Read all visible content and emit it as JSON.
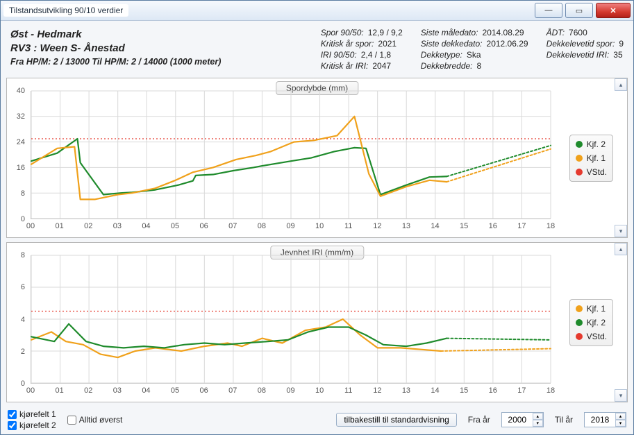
{
  "window": {
    "title": "Tilstandsutvikling 90/10 verdier"
  },
  "header": {
    "region": "Øst - Hedmark",
    "road": "RV3 : Ween S- Ånestad",
    "range": "Fra HP/M: 2 / 13000 Til HP/M: 2 / 14000 (1000 meter)",
    "col1": [
      {
        "lbl": "Spor 90/50:",
        "val": "12,9 / 9,2"
      },
      {
        "lbl": "Kritisk år spor:",
        "val": "2021"
      },
      {
        "lbl": "IRI 90/50:",
        "val": "2,4 / 1,8"
      },
      {
        "lbl": "Kritisk år IRI:",
        "val": "2047"
      }
    ],
    "col2": [
      {
        "lbl": "Siste måledato:",
        "val": "2014.08.29"
      },
      {
        "lbl": "Siste dekkedato:",
        "val": "2012.06.29"
      },
      {
        "lbl": "Dekketype:",
        "val": "Ska"
      },
      {
        "lbl": "Dekkebredde:",
        "val": "8"
      }
    ],
    "col3": [
      {
        "lbl": "ÅDT:",
        "val": "7600"
      },
      {
        "lbl": "Dekkelevetid spor:",
        "val": "9"
      },
      {
        "lbl": "Dekkelevetid IRI:",
        "val": "35"
      }
    ]
  },
  "footer": {
    "k1": "kjørefelt 1",
    "k2": "kjørefelt 2",
    "always": "Alltid øverst",
    "reset": "tilbakestill til standardvisning",
    "fra": "Fra år",
    "til": "Til år",
    "fraVal": "2000",
    "tilVal": "2018"
  },
  "chart_data": [
    {
      "type": "line",
      "title": "Spordybde (mm)",
      "x": [
        0,
        1,
        2,
        3,
        4,
        5,
        6,
        7,
        8,
        9,
        10,
        11,
        12,
        13,
        14,
        15,
        16,
        17,
        18
      ],
      "xticklabels": [
        "00",
        "01",
        "02",
        "03",
        "04",
        "05",
        "06",
        "07",
        "08",
        "09",
        "10",
        "11",
        "12",
        "13",
        "14",
        "15",
        "16",
        "17",
        "18"
      ],
      "ylim": [
        0,
        40
      ],
      "yticks": [
        0,
        8,
        16,
        24,
        32,
        40
      ],
      "threshold": 25,
      "series": [
        {
          "name": "Kjf. 2",
          "color": "#1f8b2c",
          "x": [
            0,
            0.9,
            1.6,
            1.7,
            2.5,
            3.1,
            3.5,
            4.3,
            5.1,
            5.6,
            5.7,
            6.3,
            7.0,
            7.7,
            8.0,
            9.0,
            9.7,
            10.5,
            11.2,
            11.6,
            12.1,
            13.0,
            13.8,
            14.4
          ],
          "y": [
            18.0,
            20.5,
            25.0,
            17.5,
            7.5,
            8.0,
            8.2,
            9.0,
            10.5,
            11.8,
            13.5,
            13.8,
            15.0,
            16.0,
            16.5,
            18.0,
            19.0,
            21.0,
            22.2,
            22.0,
            7.5,
            10.5,
            13.0,
            13.2
          ],
          "proj_x": [
            14.4,
            18
          ],
          "proj_y": [
            13.2,
            22.9
          ]
        },
        {
          "name": "Kjf. 1",
          "color": "#f0a11b",
          "x": [
            0,
            0.9,
            1.5,
            1.7,
            2.2,
            3.0,
            3.5,
            4.3,
            5.0,
            5.6,
            6.3,
            7.1,
            7.8,
            8.3,
            9.1,
            9.8,
            10.6,
            11.2,
            11.7,
            12.1,
            13.0,
            13.8,
            14.4
          ],
          "y": [
            17.0,
            22.0,
            22.5,
            6.0,
            6.0,
            7.5,
            8.0,
            9.5,
            12.0,
            14.5,
            16.0,
            18.5,
            19.8,
            21.0,
            24.0,
            24.5,
            26.0,
            32.0,
            14.0,
            7.0,
            10.0,
            12.0,
            11.5
          ],
          "proj_x": [
            14.4,
            18
          ],
          "proj_y": [
            11.5,
            21.8
          ]
        }
      ],
      "legend": [
        {
          "name": "Kjf. 2",
          "color": "#1f8b2c"
        },
        {
          "name": "Kjf. 1",
          "color": "#f0a11b"
        },
        {
          "name": "VStd.",
          "color": "#e53a2e"
        }
      ]
    },
    {
      "type": "line",
      "title": "Jevnhet IRI (mm/m)",
      "x": [
        0,
        1,
        2,
        3,
        4,
        5,
        6,
        7,
        8,
        9,
        10,
        11,
        12,
        13,
        14,
        15,
        16,
        17,
        18
      ],
      "xticklabels": [
        "00",
        "01",
        "02",
        "03",
        "04",
        "05",
        "06",
        "07",
        "08",
        "09",
        "10",
        "11",
        "12",
        "13",
        "14",
        "15",
        "16",
        "17",
        "18"
      ],
      "ylim": [
        0,
        8
      ],
      "yticks": [
        0,
        2,
        4,
        6,
        8
      ],
      "threshold": 4.5,
      "series": [
        {
          "name": "Kjf. 1",
          "color": "#f0a11b",
          "x": [
            0,
            0.7,
            1.2,
            1.8,
            2.4,
            3.0,
            3.6,
            4.3,
            5.2,
            6.0,
            6.8,
            7.3,
            8.0,
            8.7,
            9.5,
            10.2,
            10.8,
            11.4,
            12.0,
            12.8,
            13.5,
            14.2
          ],
          "y": [
            2.7,
            3.2,
            2.6,
            2.4,
            1.8,
            1.6,
            2.0,
            2.2,
            2.0,
            2.3,
            2.5,
            2.3,
            2.8,
            2.5,
            3.3,
            3.5,
            4.0,
            3.0,
            2.2,
            2.2,
            2.1,
            2.0
          ],
          "proj_x": [
            14.2,
            18
          ],
          "proj_y": [
            2.0,
            2.15
          ]
        },
        {
          "name": "Kjf. 2",
          "color": "#1f8b2c",
          "x": [
            0,
            0.8,
            1.3,
            1.9,
            2.5,
            3.2,
            3.9,
            4.6,
            5.3,
            6.0,
            6.7,
            7.4,
            8.2,
            8.9,
            9.6,
            10.3,
            11.0,
            11.6,
            12.2,
            13.0,
            13.7,
            14.4
          ],
          "y": [
            2.9,
            2.6,
            3.7,
            2.6,
            2.3,
            2.2,
            2.3,
            2.2,
            2.4,
            2.5,
            2.4,
            2.5,
            2.6,
            2.7,
            3.2,
            3.5,
            3.5,
            3.0,
            2.4,
            2.3,
            2.5,
            2.8
          ],
          "proj_x": [
            14.4,
            18
          ],
          "proj_y": [
            2.8,
            2.7
          ]
        }
      ],
      "legend": [
        {
          "name": "Kjf. 1",
          "color": "#f0a11b"
        },
        {
          "name": "Kjf. 2",
          "color": "#1f8b2c"
        },
        {
          "name": "VStd.",
          "color": "#e53a2e"
        }
      ]
    }
  ]
}
